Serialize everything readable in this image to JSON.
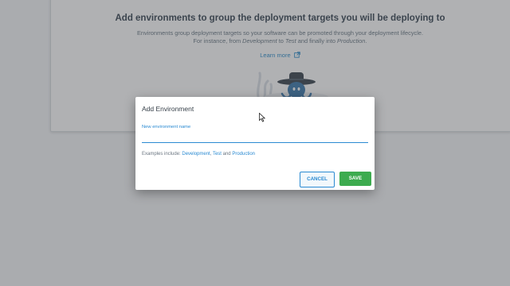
{
  "background": {
    "title": "Add environments to group the deployment targets you will be deploying to",
    "description_line1": "Environments group deployment targets so your software can be promoted through your deployment lifecycle.",
    "description_line2_prefix": "For instance, from ",
    "description_line2_dev": "Development",
    "description_line2_mid": " to ",
    "description_line2_test": "Test",
    "description_line2_and": " and finally into ",
    "description_line2_prod": "Production",
    "description_line2_suffix": ".",
    "learn_more": "Learn more"
  },
  "dialog": {
    "title": "Add Environment",
    "field_label": "New environment name",
    "field_value": "",
    "examples_prefix": "Examples include: ",
    "example_1": "Development",
    "example_sep1": ", ",
    "example_2": "Test",
    "example_sep2": " and ",
    "example_3": "Production",
    "cancel_label": "CANCEL",
    "save_label": "SAVE"
  },
  "colors": {
    "accent": "#2a8ad2",
    "save": "#3dab4f",
    "overlay": "rgba(80,82,86,0.45)"
  },
  "icons": [
    "external-link-icon",
    "cowboy-octopus-illustration",
    "mouse-cursor-icon"
  ]
}
